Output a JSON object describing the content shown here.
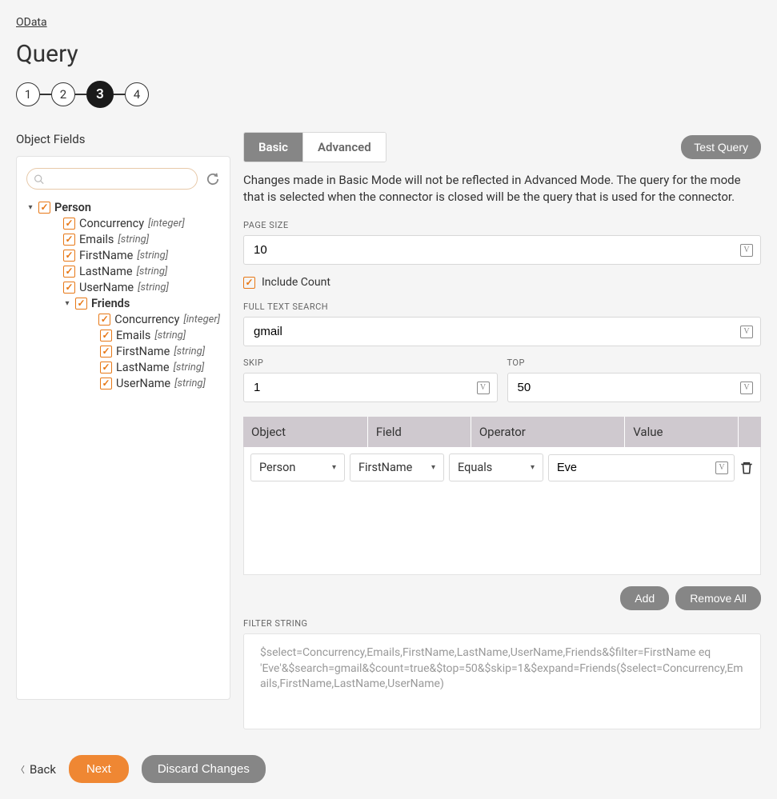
{
  "breadcrumb": "OData",
  "page_title": "Query",
  "steps": {
    "items": [
      "1",
      "2",
      "3",
      "4"
    ],
    "active": 3
  },
  "left_label": "Object Fields",
  "search_placeholder": "",
  "tree": {
    "root": {
      "label": "Person"
    },
    "fields": [
      {
        "label": "Concurrency",
        "type": "[integer]"
      },
      {
        "label": "Emails",
        "type": "[string]"
      },
      {
        "label": "FirstName",
        "type": "[string]"
      },
      {
        "label": "LastName",
        "type": "[string]"
      },
      {
        "label": "UserName",
        "type": "[string]"
      }
    ],
    "nested": {
      "label": "Friends"
    },
    "nested_fields": [
      {
        "label": "Concurrency",
        "type": "[integer]"
      },
      {
        "label": "Emails",
        "type": "[string]"
      },
      {
        "label": "FirstName",
        "type": "[string]"
      },
      {
        "label": "LastName",
        "type": "[string]"
      },
      {
        "label": "UserName",
        "type": "[string]"
      }
    ]
  },
  "tabs": {
    "basic": "Basic",
    "advanced": "Advanced"
  },
  "test_query": "Test Query",
  "info_text": "Changes made in Basic Mode will not be reflected in Advanced Mode. The query for the mode that is selected when the connector is closed will be the query that is used for the connector.",
  "page_size": {
    "label": "PAGE SIZE",
    "value": "10"
  },
  "include_count": "Include Count",
  "full_text": {
    "label": "FULL TEXT SEARCH",
    "value": "gmail"
  },
  "skip": {
    "label": "SKIP",
    "value": "1"
  },
  "top": {
    "label": "TOP",
    "value": "50"
  },
  "table": {
    "headers": {
      "object": "Object",
      "field": "Field",
      "operator": "Operator",
      "value": "Value"
    },
    "row": {
      "object": "Person",
      "field": "FirstName",
      "operator": "Equals",
      "value": "Eve"
    }
  },
  "buttons": {
    "add": "Add",
    "remove_all": "Remove All"
  },
  "filter_string": {
    "label": "FILTER STRING",
    "value": "$select=Concurrency,Emails,FirstName,LastName,UserName,Friends&$filter=FirstName eq 'Eve'&$search=gmail&$count=true&$top=50&$skip=1&$expand=Friends($select=Concurrency,Emails,FirstName,LastName,UserName)"
  },
  "footer": {
    "back": "Back",
    "next": "Next",
    "discard": "Discard Changes"
  }
}
